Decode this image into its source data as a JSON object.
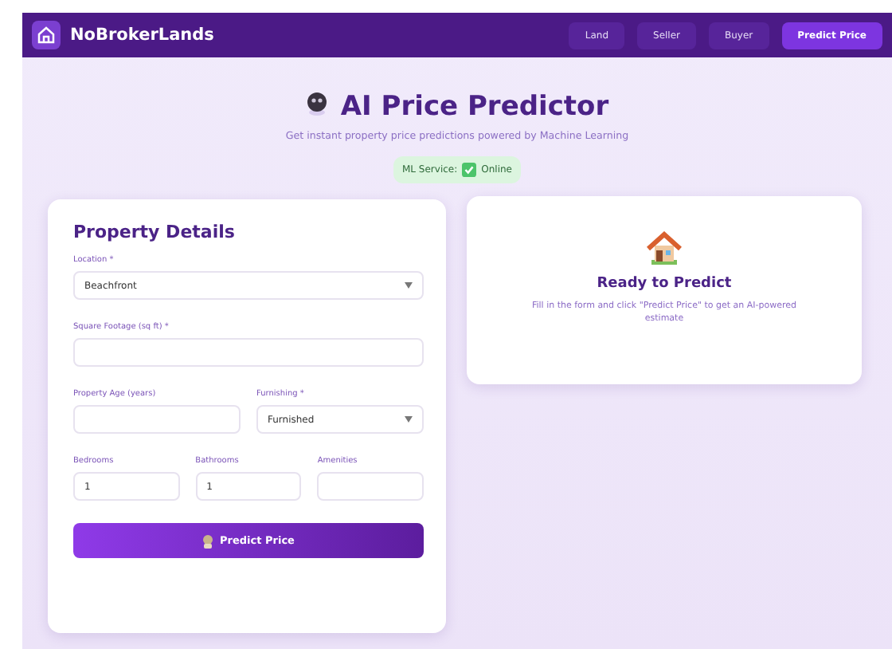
{
  "navbar": {
    "brand": "NoBrokerLands",
    "links": [
      {
        "label": "Land",
        "selected": false
      },
      {
        "label": "Seller",
        "selected": false
      },
      {
        "label": "Buyer",
        "selected": false
      },
      {
        "label": "Predict Price",
        "selected": true
      }
    ]
  },
  "header": {
    "title": "AI Price Predictor",
    "subtitle": "Get instant property price predictions powered by Machine Learning",
    "service_label": "ML Service:",
    "service_status": "Online"
  },
  "form": {
    "title": "Property Details",
    "rows": [
      [
        {
          "label": "Location *",
          "kind": "select",
          "value": "Beachfront"
        }
      ],
      [
        {
          "label": "Square Footage (sq ft) *",
          "kind": "input"
        }
      ],
      [
        {
          "label": "Property Age (years)",
          "kind": "input"
        },
        {
          "label": "Furnishing *",
          "kind": "select",
          "value": "Furnished"
        }
      ],
      [
        {
          "label": "Bedrooms",
          "kind": "input",
          "value": "1"
        },
        {
          "label": "Bathrooms",
          "kind": "input",
          "value": "1"
        },
        {
          "label": "Amenities",
          "kind": "input"
        }
      ]
    ],
    "submit": "Predict Price"
  },
  "result": {
    "title": "Ready to Predict",
    "message": "Fill in the form and click \"Predict Price\" to get an AI-powered estimate"
  }
}
